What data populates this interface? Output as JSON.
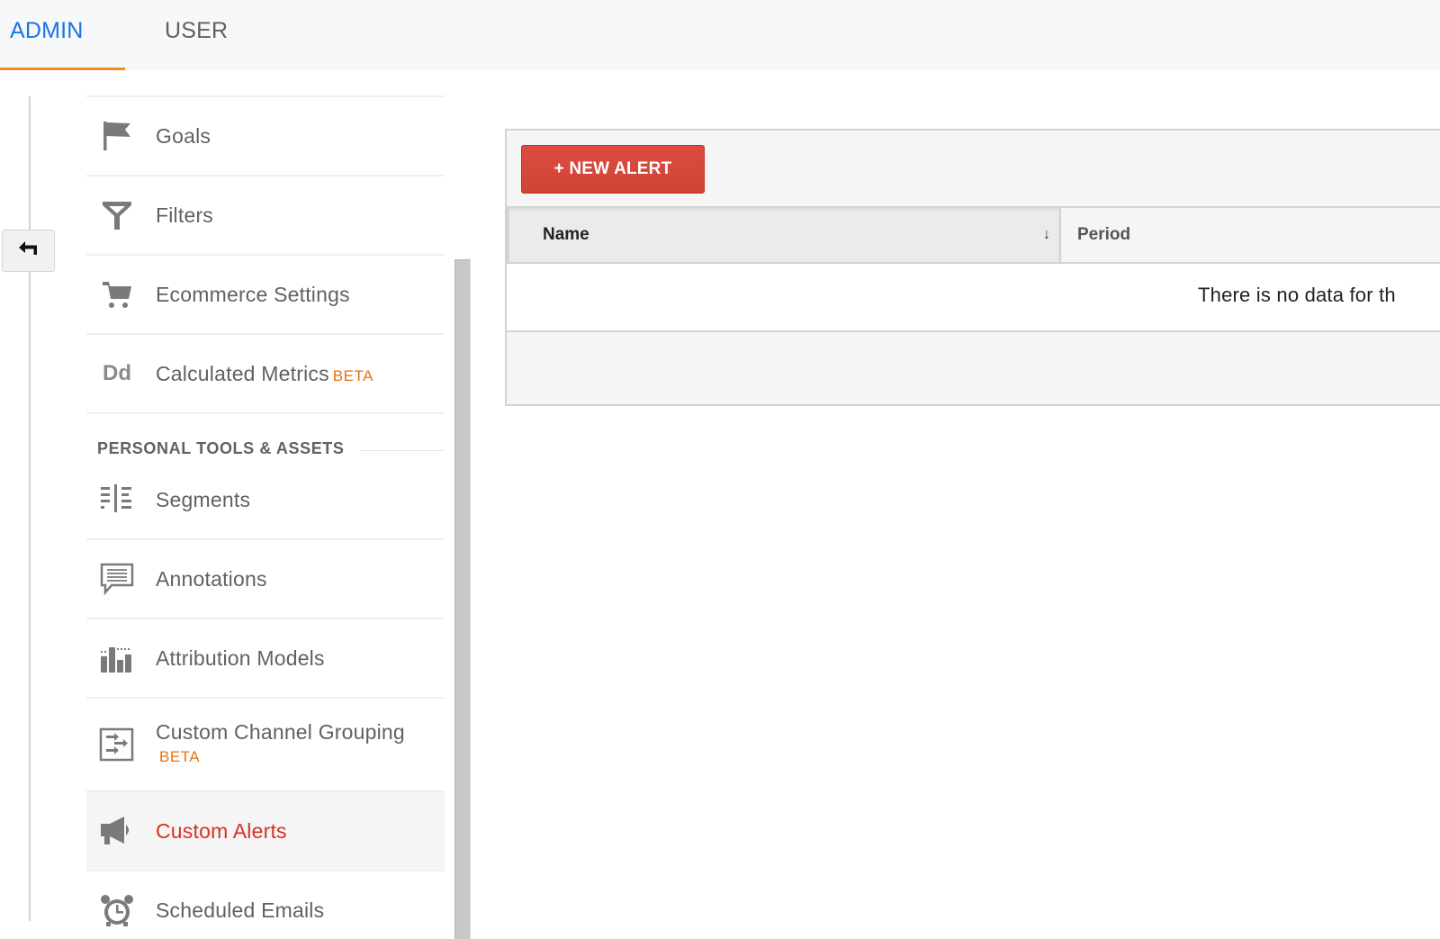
{
  "header": {
    "tabs": [
      {
        "label": "ADMIN",
        "active": true
      },
      {
        "label": "USER",
        "active": false
      }
    ],
    "accent_color": "#1a73e8",
    "active_underline_color": "#f58b1f"
  },
  "back_button": {
    "icon": "back-arrow-icon"
  },
  "sidebar": {
    "items": [
      {
        "label": "Goals",
        "icon": "flag-icon"
      },
      {
        "label": "Filters",
        "icon": "filter-icon"
      },
      {
        "label": "Ecommerce Settings",
        "icon": "cart-icon"
      },
      {
        "label": "Calculated Metrics",
        "badge": "BETA",
        "icon": "dd-icon",
        "icon_text": "Dd"
      }
    ],
    "section": {
      "title": "PERSONAL TOOLS & ASSETS",
      "items": [
        {
          "label": "Segments",
          "icon": "segments-icon"
        },
        {
          "label": "Annotations",
          "icon": "annotation-icon"
        },
        {
          "label": "Attribution Models",
          "icon": "attribution-icon"
        },
        {
          "label": "Custom Channel Grouping",
          "badge": "BETA",
          "icon": "channel-grouping-icon"
        },
        {
          "label": "Custom Alerts",
          "icon": "megaphone-icon",
          "active": true
        },
        {
          "label": "Scheduled Emails",
          "icon": "alarm-clock-icon"
        }
      ]
    },
    "active_color": "#d93025",
    "beta_color": "#e8710a"
  },
  "main": {
    "new_alert_button": "+ NEW ALERT",
    "button_color": "#d54538",
    "table": {
      "columns": [
        {
          "label": "Name",
          "sorted": true,
          "sort_icon": "↓"
        },
        {
          "label": "Period"
        }
      ],
      "empty_message": "There is no data for th"
    }
  }
}
